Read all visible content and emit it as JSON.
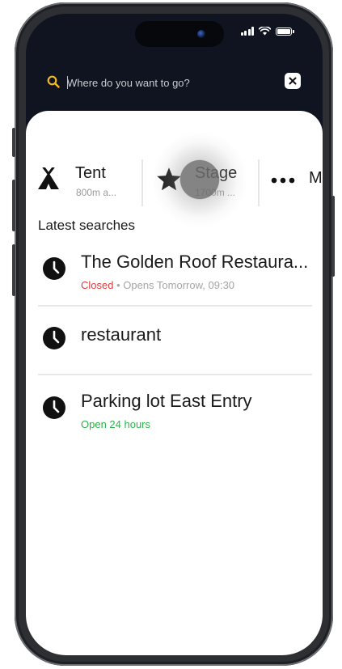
{
  "status_bar": {
    "icons": [
      "signal-icon",
      "wifi-icon",
      "battery-icon"
    ]
  },
  "search": {
    "placeholder": "Where do you want to go?",
    "value": ""
  },
  "categories": [
    {
      "name": "Tent",
      "distance": "800m a...",
      "icon": "tent-icon"
    },
    {
      "name": "Stage",
      "distance": "1700m ...",
      "icon": "star-icon"
    },
    {
      "name": "M",
      "icon": "more-dots-icon"
    }
  ],
  "recent": {
    "title": "Latest searches",
    "items": [
      {
        "title": "The Golden Roof Restaura...",
        "status": "Closed",
        "status_separator": " • ",
        "detail": "Opens Tomorrow, 09:30"
      },
      {
        "title": "restaurant"
      },
      {
        "title": "Parking lot East Entry",
        "status": "Open 24 hours"
      }
    ]
  },
  "colors": {
    "accent": "#f1b82c",
    "closed": "#e33a3a",
    "open": "#2fb34a",
    "header_bg": "#0f1420"
  }
}
